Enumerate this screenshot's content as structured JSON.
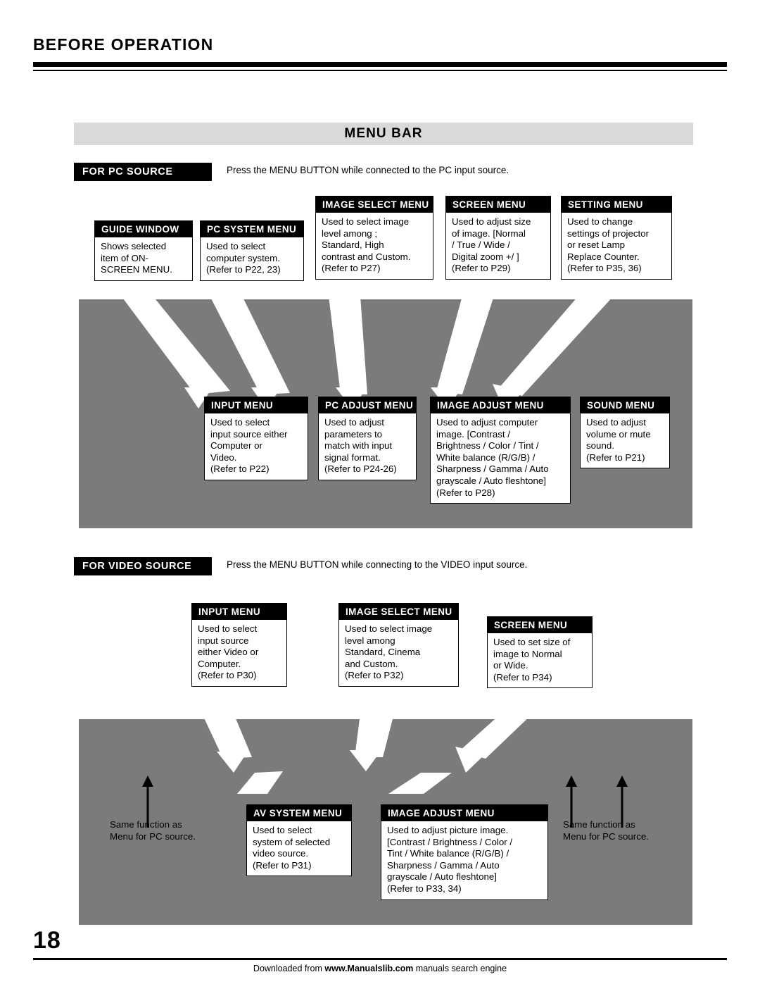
{
  "header": {
    "title": "BEFORE OPERATION"
  },
  "banner": {
    "title": "MENU BAR"
  },
  "sections": {
    "pc": {
      "tag": "FOR PC SOURCE",
      "note": "Press the MENU BUTTON while connected to the PC input source."
    },
    "video": {
      "tag": "FOR VIDEO SOURCE",
      "note": "Press the MENU BUTTON while connecting to the VIDEO input source."
    }
  },
  "pc_callouts": [
    {
      "caption": "GUIDE WINDOW",
      "body": "Shows selected\nitem of ON-\nSCREEN MENU."
    },
    {
      "caption": "PC SYSTEM MENU",
      "body": "Used to select\ncomputer system.\n(Refer to P22, 23)"
    },
    {
      "caption": "IMAGE SELECT MENU",
      "body": "Used to select image\nlevel among ;\nStandard, High\ncontrast and Custom.\n(Refer to P27)"
    },
    {
      "caption": "SCREEN MENU",
      "body": "Used to adjust size\nof image.  [Normal\n/ True / Wide /\nDigital zoom +/  ]\n(Refer to P29)"
    },
    {
      "caption": "SETTING MENU",
      "body": "Used to change\nsettings of projector\nor reset Lamp\nReplace Counter.\n(Refer to P35, 36)"
    },
    {
      "caption": "INPUT MENU",
      "body": "Used to select\ninput source either\nComputer or\nVideo.\n(Refer to P22)"
    },
    {
      "caption": "PC ADJUST MENU",
      "body": "Used to adjust\nparameters to\nmatch with input\nsignal format.\n(Refer to P24-26)"
    },
    {
      "caption": "IMAGE ADJUST MENU",
      "body": "Used to adjust computer\nimage. [Contrast /\nBrightness / Color / Tint /\nWhite balance (R/G/B) /\nSharpness /  Gamma / Auto\ngrayscale / Auto fleshtone]\n(Refer to P28)"
    },
    {
      "caption": "SOUND MENU",
      "body": "Used to adjust\nvolume or mute\nsound.\n(Refer to P21)"
    }
  ],
  "video_callouts": [
    {
      "caption": "INPUT MENU",
      "body": "Used to select\ninput source\neither Video or\nComputer.\n(Refer to P30)"
    },
    {
      "caption": "IMAGE SELECT MENU",
      "body": "Used to select image\nlevel among\nStandard, Cinema\nand Custom.\n(Refer to P32)"
    },
    {
      "caption": "SCREEN MENU",
      "body": "Used to set size of\nimage to Normal\nor Wide.\n(Refer to P34)"
    },
    {
      "caption": "AV SYSTEM MENU",
      "body": "Used to select\nsystem of selected\nvideo source.\n(Refer to P31)"
    },
    {
      "caption": "IMAGE ADJUST MENU",
      "body": "Used to adjust picture image.\n[Contrast / Brightness / Color /\nTint / White balance (R/G/B) /\nSharpness / Gamma / Auto\ngrayscale / Auto fleshtone]\n(Refer to P33, 34)"
    }
  ],
  "video_plain_notes": [
    {
      "text": "Same function as\nMenu for PC source."
    },
    {
      "text": "Same function as\nMenu for PC source."
    }
  ],
  "footer": {
    "page_number": "18",
    "downloaded_prefix": "Downloaded from ",
    "site": "www.Manualslib.com",
    "downloaded_suffix": " manuals search engine"
  }
}
